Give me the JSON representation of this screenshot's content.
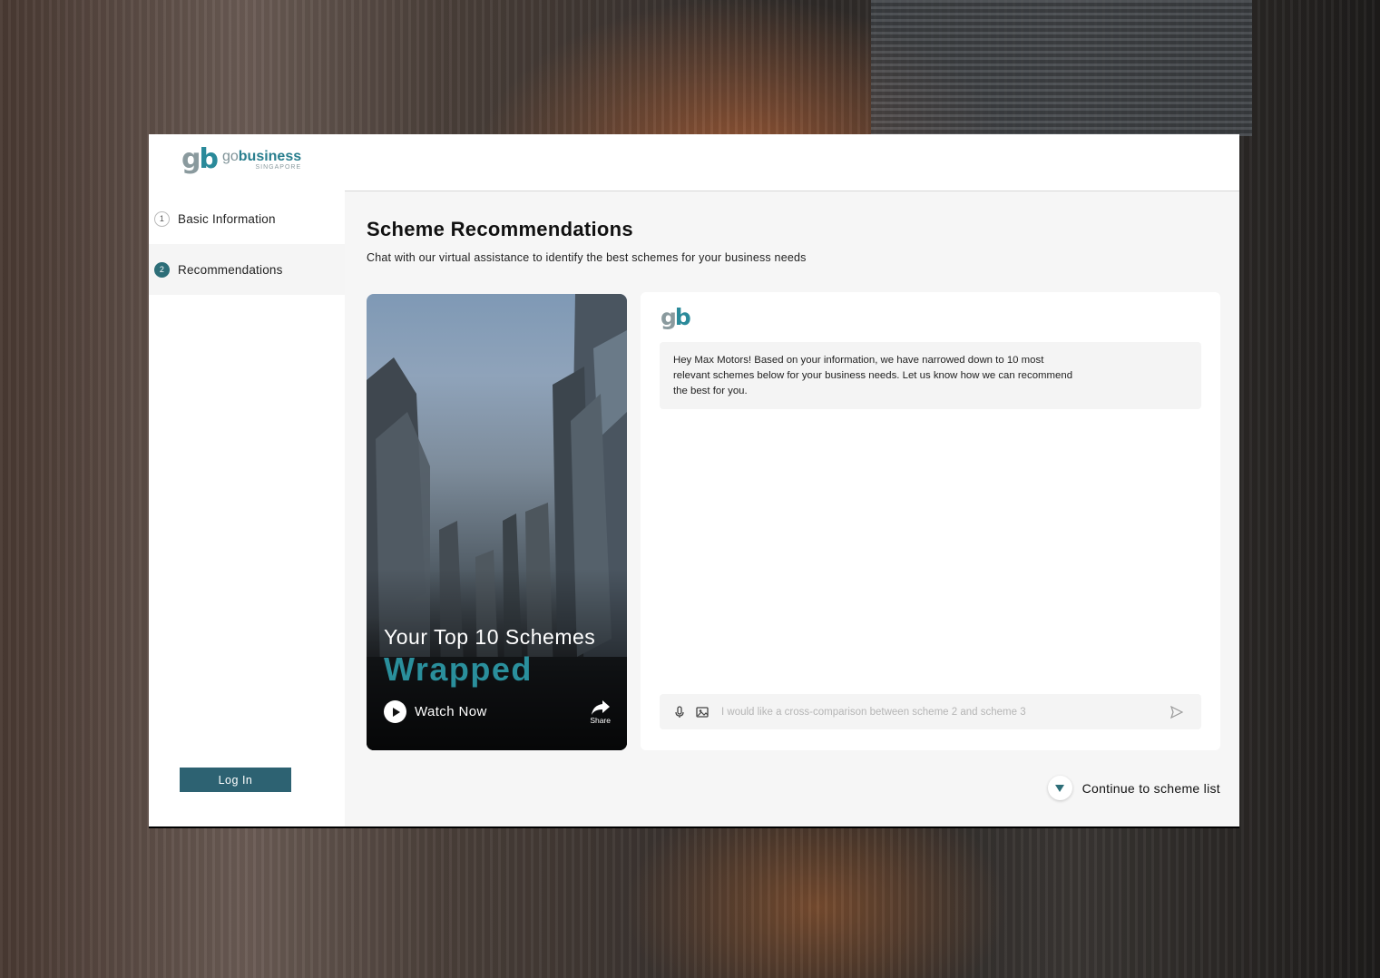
{
  "brand": {
    "logo_mark_g": "g",
    "logo_mark_b": "b",
    "logo_go": "go",
    "logo_business": "business",
    "logo_singapore": "SINGAPORE",
    "primary_color": "#2d6e78",
    "accent_color": "#2a8f9c"
  },
  "sidebar": {
    "steps": [
      {
        "number": "1",
        "label": "Basic Information"
      },
      {
        "number": "2",
        "label": "Recommendations"
      }
    ],
    "login_label": "Log In"
  },
  "main": {
    "title": "Scheme Recommendations",
    "subtitle": "Chat with our virtual assistance to identify the best schemes for your business needs"
  },
  "video": {
    "headline": "Your Top 10 Schemes",
    "highlight": "Wrapped",
    "watch_label": "Watch Now",
    "share_label": "Share",
    "play_icon": "play-icon",
    "share_icon": "share-icon"
  },
  "chat": {
    "avatar_g": "g",
    "avatar_b": "b",
    "message": "Hey Max Motors! Based on your information, we have narrowed down to 10 most relevant schemes below for your business needs. Let us know how we can recommend the best for you.",
    "input_placeholder": "I would like a cross-comparison between scheme 2 and scheme 3",
    "mic_icon": "microphone-icon",
    "image_icon": "image-icon",
    "send_icon": "send-icon"
  },
  "footer": {
    "continue_label": "Continue to scheme list",
    "continue_icon": "chevron-down-icon"
  }
}
